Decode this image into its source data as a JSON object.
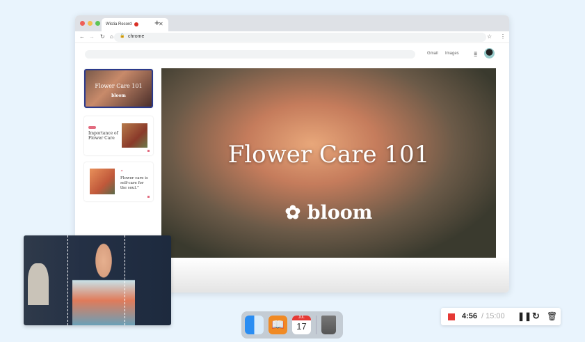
{
  "browser": {
    "tab_title": "Wistia Record",
    "url": "chrome",
    "links": [
      "Gmail",
      "Images"
    ]
  },
  "slides": [
    {
      "title": "Flower Care 101",
      "logo": "bloom"
    },
    {
      "heading": "Importance of Flower Care"
    },
    {
      "quote_mark": "“",
      "quote": "Flower care is self-care for the soul.”"
    }
  ],
  "main_slide": {
    "title": "Flower Care 101",
    "logo": "bloom"
  },
  "dock": {
    "calendar_month": "JUL",
    "calendar_day": "17"
  },
  "recorder": {
    "elapsed": "4:56",
    "limit": "/ 15:00",
    "accent": "#e53935"
  }
}
